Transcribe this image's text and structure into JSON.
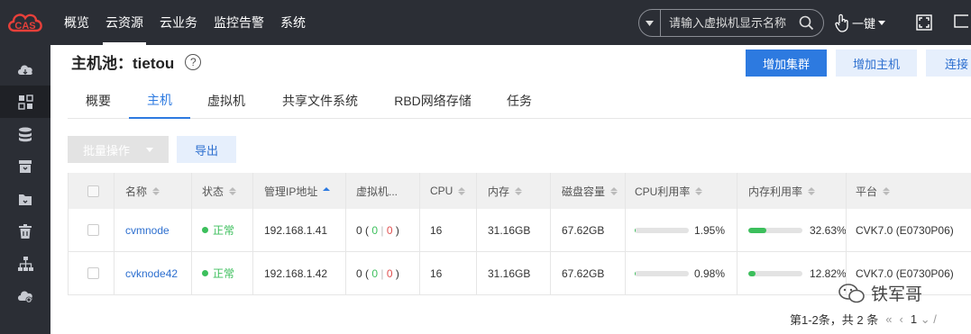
{
  "app": {
    "logo_text": "CAS"
  },
  "nav": [
    {
      "label": "概览"
    },
    {
      "label": "云资源"
    },
    {
      "label": "云业务"
    },
    {
      "label": "监控告警"
    },
    {
      "label": "系统"
    }
  ],
  "search": {
    "placeholder": "请输入虚拟机显示名称"
  },
  "onekey": {
    "label": "一键"
  },
  "sidebar": {
    "items": [
      {
        "icon": "cloud-icon"
      },
      {
        "icon": "dashboard-grid-icon"
      },
      {
        "icon": "database-icon"
      },
      {
        "icon": "archive-box-icon"
      },
      {
        "icon": "folder-icon"
      },
      {
        "icon": "trash-icon"
      },
      {
        "icon": "network-tree-icon"
      },
      {
        "icon": "cloud-settings-icon"
      }
    ]
  },
  "page": {
    "title": "主机池：tietou"
  },
  "actions": {
    "add_cluster": "增加集群",
    "add_host": "增加主机",
    "connect": "连接"
  },
  "tabs": [
    {
      "label": "概要"
    },
    {
      "label": "主机"
    },
    {
      "label": "虚拟机"
    },
    {
      "label": "共享文件系统"
    },
    {
      "label": "RBD网络存储"
    },
    {
      "label": "任务"
    }
  ],
  "toolbar": {
    "batch_label": "批量操作",
    "export_label": "导出"
  },
  "table": {
    "columns": [
      "名称",
      "状态",
      "管理IP地址",
      "虚拟机...",
      "CPU",
      "内存",
      "磁盘容量",
      "CPU利用率",
      "内存利用率",
      "平台"
    ],
    "rows": [
      {
        "name": "cvmnode",
        "status": "正常",
        "ip": "192.168.1.41",
        "vm_open": "0 (",
        "vm_running": "0",
        "vm_sep": "|",
        "vm_stopped": "0",
        "vm_close": ")",
        "cpu": "16",
        "memory": "31.16GB",
        "disk": "67.62GB",
        "cpu_usage": "1.95%",
        "cpu_usage_value": 1.95,
        "mem_usage": "32.63%",
        "mem_usage_value": 32.63,
        "platform": "CVK7.0 (E0730P06)"
      },
      {
        "name": "cvknode42",
        "status": "正常",
        "ip": "192.168.1.42",
        "vm_open": "0 (",
        "vm_running": "0",
        "vm_sep": "|",
        "vm_stopped": "0",
        "vm_close": ")",
        "cpu": "16",
        "memory": "31.16GB",
        "disk": "67.62GB",
        "cpu_usage": "0.98%",
        "cpu_usage_value": 0.98,
        "mem_usage": "12.82%",
        "mem_usage_value": 12.82,
        "platform": "CVK7.0 (E0730P06)"
      }
    ]
  },
  "pager": {
    "summary": "第1-2条，共 2 条",
    "page": "1",
    "total_fragment": "/"
  },
  "watermark": {
    "text": "铁军哥"
  },
  "colors": {
    "topbar": "#2b2e35",
    "primary": "#2d7ae0",
    "status_ok": "#3cbf5c",
    "stopped": "#e05050"
  }
}
